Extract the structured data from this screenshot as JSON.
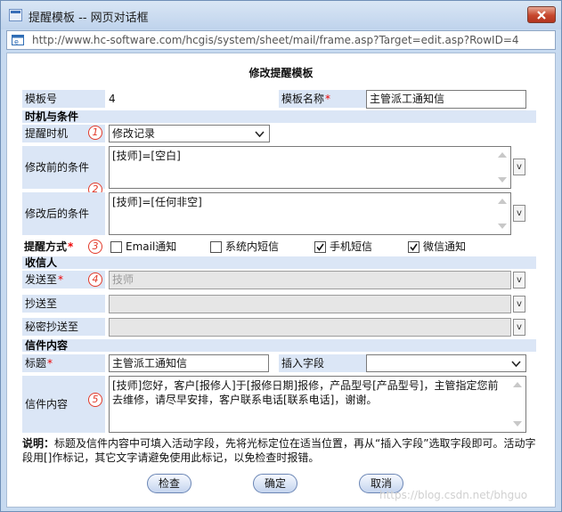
{
  "window": {
    "title": "提醒模板 -- 网页对话框",
    "url": "http://www.hc-software.com/hcgis/system/sheet/mail/frame.asp?Target=edit.asp?RowID=4"
  },
  "form": {
    "heading": "修改提醒模板",
    "template_no_label": "模板号",
    "template_no": "4",
    "template_name_label": "模板名称",
    "template_name": "主管派工通知信",
    "required_mark": "*",
    "section_timing": "时机与条件",
    "remind_time_label": "提醒时机",
    "remind_time_value": "修改记录",
    "before_label": "修改前的条件",
    "before_value": "[技师]=[空白]",
    "after_label": "修改后的条件",
    "after_value": "[技师]=[任何非空]",
    "v_label": "v",
    "method_label": "提醒方式",
    "methods": [
      {
        "label": "Email通知",
        "checked": false
      },
      {
        "label": "系统内短信",
        "checked": false
      },
      {
        "label": "手机短信",
        "checked": true
      },
      {
        "label": "微信通知",
        "checked": true
      }
    ],
    "section_recipients": "收信人",
    "send_to_label": "发送至",
    "send_to_value": "技师",
    "cc_label": "抄送至",
    "bcc_label": "秘密抄送至",
    "section_content": "信件内容",
    "subject_label": "标题",
    "subject_value": "主管派工通知信",
    "insert_field_label": "插入字段",
    "body_label": "信件内容",
    "body_value": "[技师]您好，客户[报修人]于[报修日期]报修，产品型号[产品型号]，主管指定您前去维修，请尽早安排，客户联系电话[联系电话]，谢谢。",
    "note_title": "说明：",
    "note_text": "标题及信件内容中可填入活动字段，先将光标定位在适当位置，再从“插入字段”选取字段即可。活动字段用[]作标记，其它文字请避免使用此标记，以免检查时报错。",
    "markers": [
      "1",
      "2",
      "3",
      "4",
      "5"
    ]
  },
  "buttons": {
    "check": "检查",
    "ok": "确定",
    "cancel": "取消"
  },
  "watermark": "https://blog.csdn.net/bhguo"
}
